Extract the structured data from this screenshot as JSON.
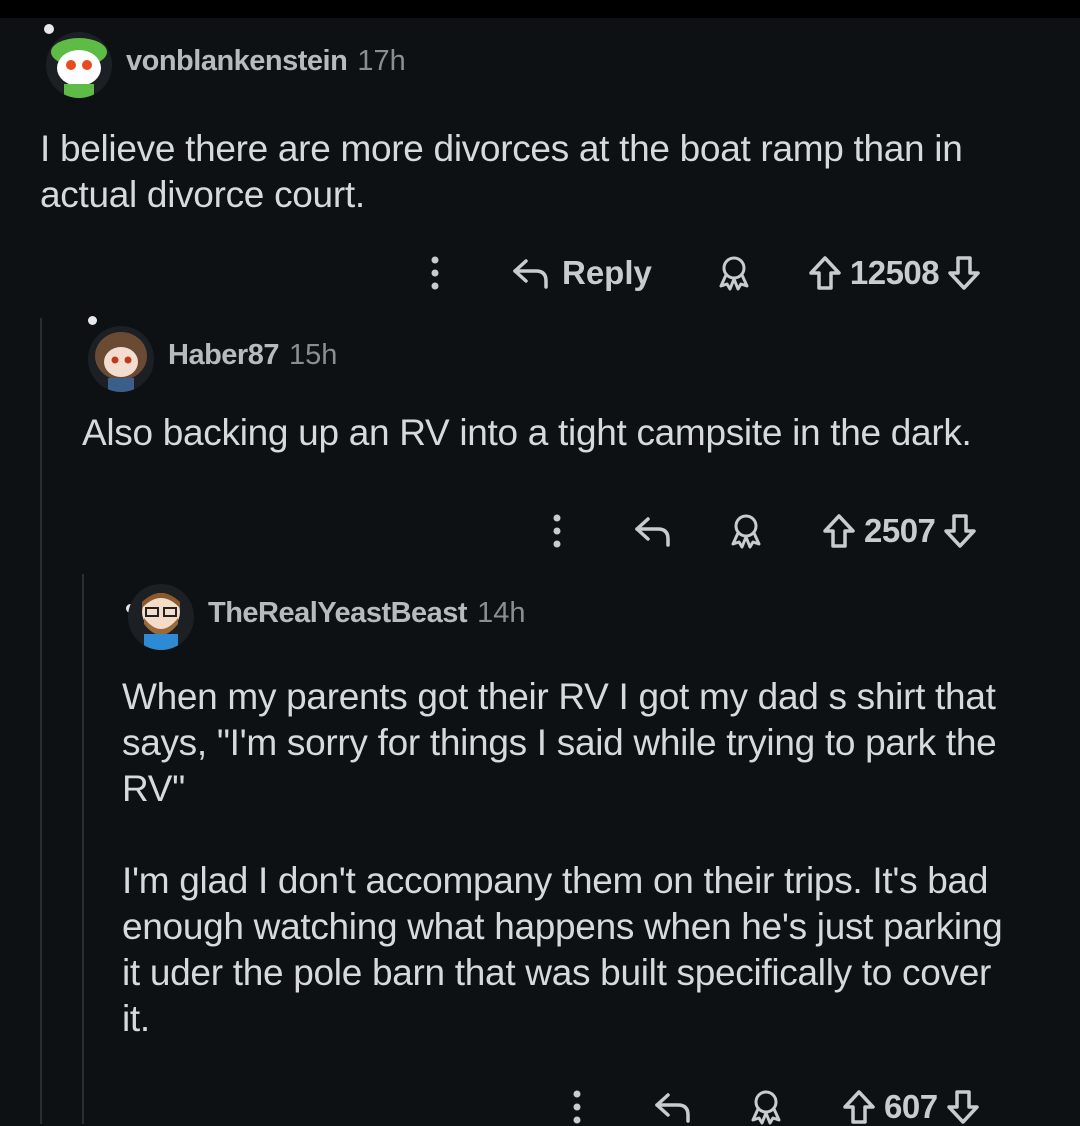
{
  "comments": [
    {
      "username": "vonblankenstein",
      "time": "17h",
      "paragraphs": [
        "I believe there are more divorces at the boat ramp than in actual divorce court."
      ],
      "reply_label": "Reply",
      "score": "12508"
    },
    {
      "username": "Haber87",
      "time": "15h",
      "paragraphs": [
        "Also backing up an RV into a tight campsite in the dark."
      ],
      "score": "2507"
    },
    {
      "username": "TheRealYeastBeast",
      "time": "14h",
      "paragraphs": [
        "When my parents got their RV I got my dad s shirt that says, \"I'm sorry for things I said while trying to park the RV\"",
        "I'm glad I don't accompany them on their trips. It's bad enough watching what happens when he's just parking it uder the pole barn that was built specifically to cover it."
      ],
      "score": "607"
    }
  ],
  "colors": {
    "background": "#0e1113",
    "text": "#d7dadc",
    "muted": "#8a8e92",
    "thread_line": "#2a2e31"
  },
  "icons": [
    "more-vertical-icon",
    "reply-arrow-icon",
    "award-icon",
    "upvote-arrow-icon",
    "downvote-arrow-icon"
  ]
}
